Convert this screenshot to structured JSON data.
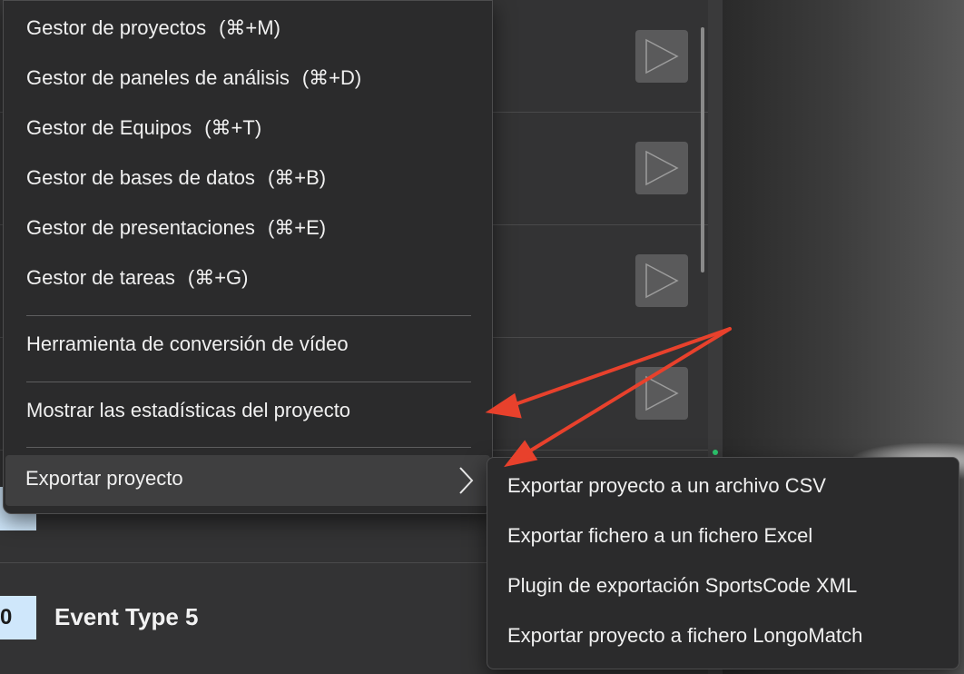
{
  "menu": {
    "items": [
      {
        "label": "Gestor de proyectos",
        "shortcut": "(⌘+M)"
      },
      {
        "label": "Gestor de paneles de análisis",
        "shortcut": "(⌘+D)"
      },
      {
        "label": "Gestor de Equipos",
        "shortcut": "(⌘+T)"
      },
      {
        "label": "Gestor de bases de datos",
        "shortcut": "(⌘+B)"
      },
      {
        "label": "Gestor de presentaciones",
        "shortcut": "(⌘+E)"
      },
      {
        "label": "Gestor de tareas",
        "shortcut": "(⌘+G)"
      }
    ],
    "video_tool": "Herramienta de conversión de vídeo",
    "show_stats": "Mostrar las estadísticas del proyecto",
    "export": "Exportar proyecto"
  },
  "submenu": {
    "items": [
      "Exportar proyecto a un archivo CSV",
      "Exportar fichero a un fichero Excel",
      "Plugin de exportación SportsCode XML",
      "Exportar proyecto a fichero LongoMatch"
    ]
  },
  "event_list": {
    "last_row": {
      "badge": "0",
      "name": "Event Type 5"
    }
  },
  "colors": {
    "annotation_arrow": "#e8412c",
    "badge": "#cfe7fb",
    "menu_bg": "#2b2b2c"
  }
}
